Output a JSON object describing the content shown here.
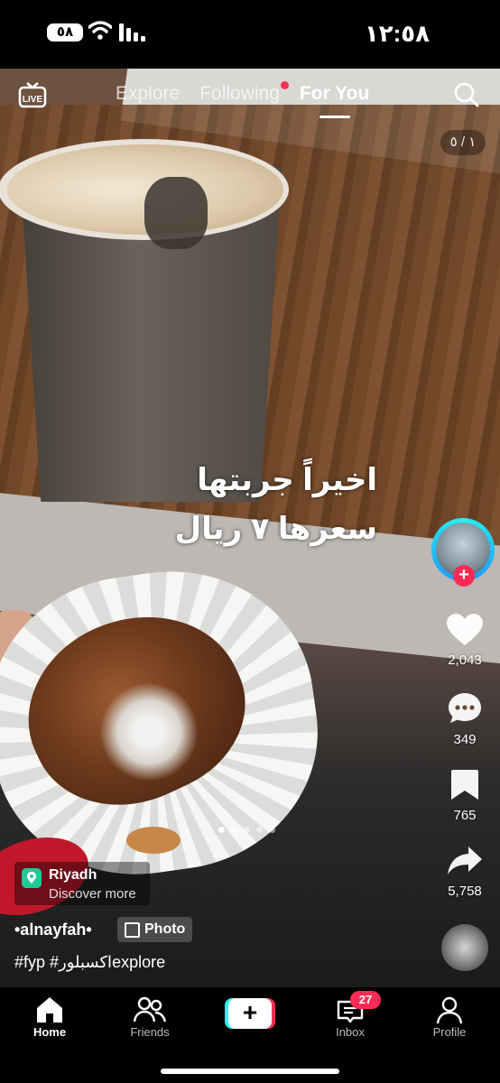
{
  "status_bar": {
    "time": "١٢:٥٨",
    "battery": "٥٨"
  },
  "top_nav": {
    "live_label": "LIVE",
    "tabs": [
      {
        "label": "Explore",
        "active": false
      },
      {
        "label": "Following",
        "active": false,
        "has_dot": true
      },
      {
        "label": "For You",
        "active": true
      }
    ]
  },
  "post": {
    "page_indicator": "١ / ٥",
    "overlay_lines": [
      "اخيراً جربتها",
      "سعرها ٧ ريال"
    ],
    "slide_count": 5,
    "current_slide": 1,
    "location": {
      "name": "Riyadh",
      "subtitle": "Discover more"
    },
    "author": "•alnayfah•",
    "type_badge": "Photo",
    "caption": "#fyp #اكسبلورexplore"
  },
  "actions": {
    "likes": "2,043",
    "comments": "349",
    "saves": "765",
    "shares": "5,758"
  },
  "tab_bar": {
    "home": "Home",
    "friends": "Friends",
    "inbox": "Inbox",
    "inbox_badge": "27",
    "profile": "Profile"
  },
  "colors": {
    "accent": "#fe2c55",
    "cyan": "#25f4ee"
  }
}
